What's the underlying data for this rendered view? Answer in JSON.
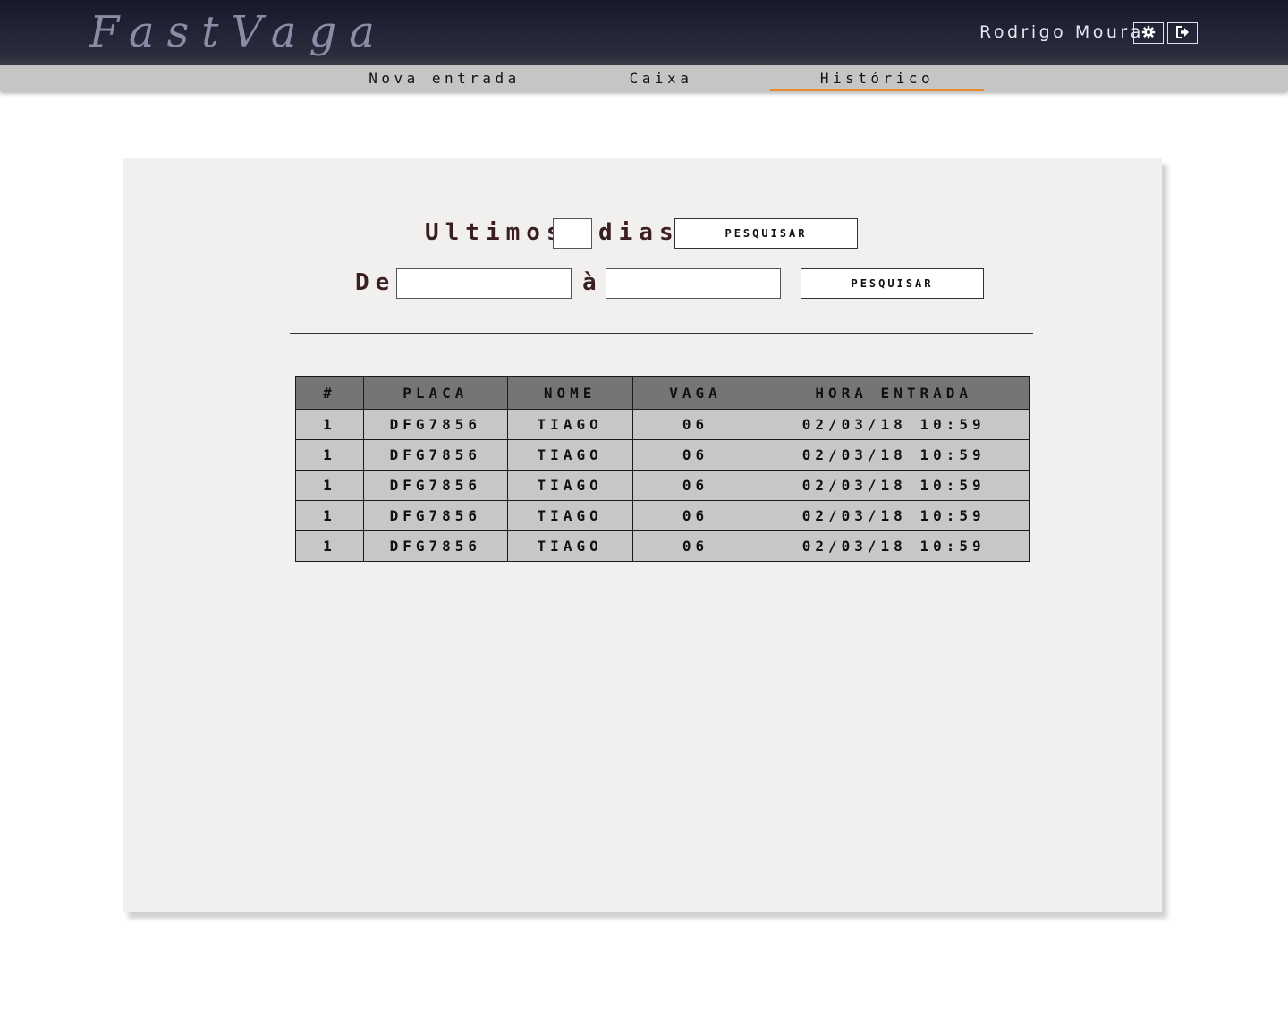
{
  "header": {
    "logo": "FastVaga",
    "user_name": "Rodrigo Moura",
    "settings_icon": "gear-icon",
    "logout_icon": "logout-icon"
  },
  "nav": {
    "items": [
      {
        "label": "Nova entrada"
      },
      {
        "label": "Caixa"
      },
      {
        "label": "Histórico",
        "active": true
      }
    ],
    "active_color": "#e38b2e"
  },
  "filters": {
    "last_days_label": "Ultimos",
    "days_label": "dias",
    "last_days_value": "",
    "search_button_1": "PESQUISAR",
    "from_label": "De",
    "to_label": "à",
    "from_value": "",
    "to_value": "",
    "search_button_2": "PESQUISAR"
  },
  "table": {
    "headers": [
      "#",
      "PLACA",
      "NOME",
      "VAGA",
      "HORA ENTRADA"
    ],
    "rows": [
      [
        "1",
        "DFG7856",
        "TIAGO",
        "06",
        "02/03/18 10:59"
      ],
      [
        "1",
        "DFG7856",
        "TIAGO",
        "06",
        "02/03/18 10:59"
      ],
      [
        "1",
        "DFG7856",
        "TIAGO",
        "06",
        "02/03/18 10:59"
      ],
      [
        "1",
        "DFG7856",
        "TIAGO",
        "06",
        "02/03/18 10:59"
      ],
      [
        "1",
        "DFG7856",
        "TIAGO",
        "06",
        "02/03/18 10:59"
      ]
    ]
  }
}
